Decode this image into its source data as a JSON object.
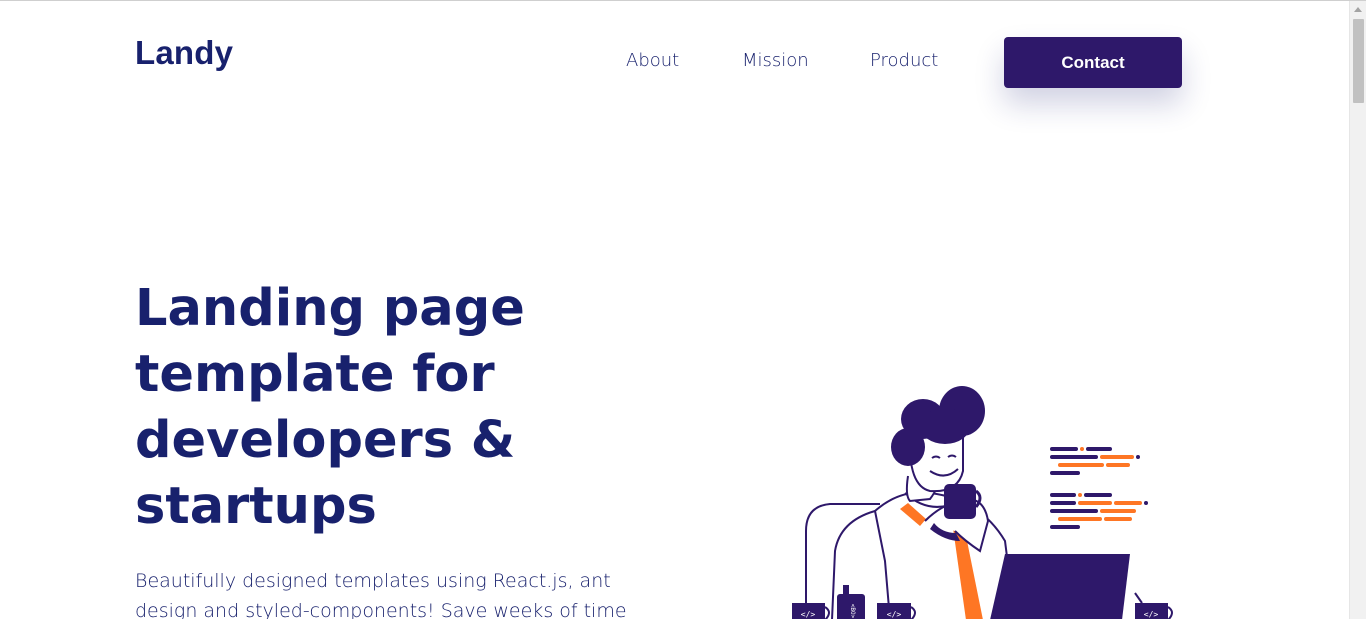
{
  "brand": {
    "logo": "Landy"
  },
  "nav": {
    "items": [
      "About",
      "Mission",
      "Product"
    ],
    "contact_label": "Contact"
  },
  "hero": {
    "title": "Landing page template for developers & startups",
    "description": "Beautifully designed templates using React.js, ant design and styled-components! Save weeks of time",
    "illustration": {
      "code_tag_1": "</>",
      "code_tag_2": "</>",
      "code_tag_3": "</>",
      "code_tag_4": "</>",
      "cup_tag": "<BO>"
    }
  },
  "colors": {
    "primary": "#18216d",
    "button": "#2e186a",
    "accent": "#fe7624"
  }
}
